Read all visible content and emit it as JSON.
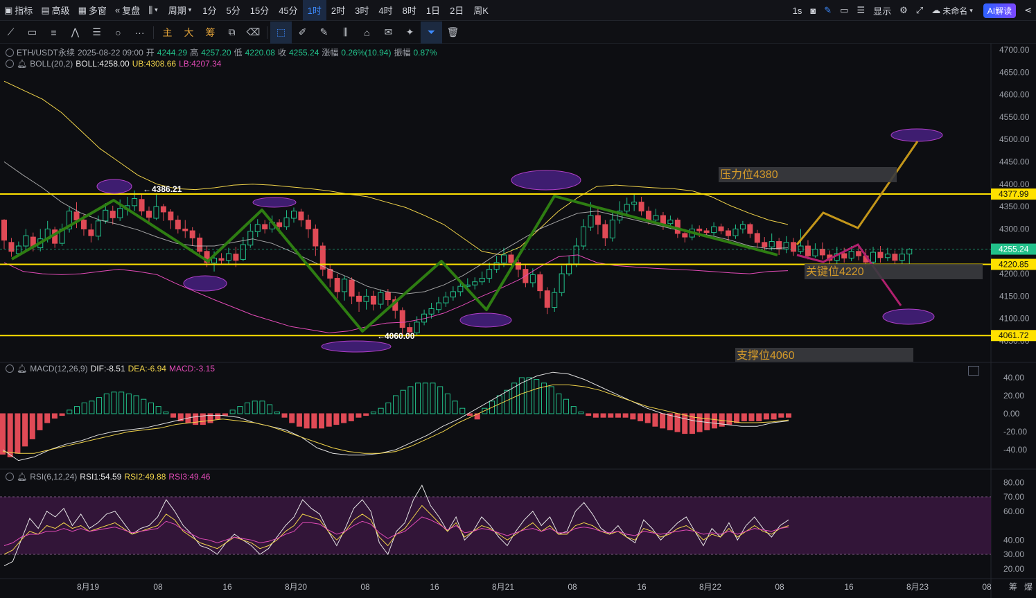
{
  "topbar": {
    "indicators": "指标",
    "advanced": "高级",
    "multi_window": "多窗",
    "replay": "复盘",
    "period": "周期",
    "intervals": [
      "1分",
      "5分",
      "15分",
      "45分",
      "1时",
      "2时",
      "3时",
      "4时",
      "8时",
      "1日",
      "2日",
      "周K"
    ],
    "active_interval": "1时",
    "refresh": "1s",
    "display": "显示",
    "unnamed": "未命名",
    "ai_read": "AI解读"
  },
  "toolbar": {
    "labels": [
      "主",
      "大",
      "筹"
    ]
  },
  "main_legend": {
    "symbol": "ETH/USDT永续",
    "datetime": "2025-08-22 09:00",
    "open_label": "开",
    "open": "4244.29",
    "high_label": "高",
    "high": "4257.20",
    "low_label": "低",
    "low": "4220.08",
    "close_label": "收",
    "close": "4255.24",
    "change_label": "涨幅",
    "change": "0.26%(10.94)",
    "amp_label": "振幅",
    "amp": "0.87%"
  },
  "boll_legend": {
    "name": "BOLL(20,2)",
    "boll": "BOLL:4258.00",
    "ub": "UB:4308.66",
    "lb": "LB:4207.34"
  },
  "macd_legend": {
    "name": "MACD(12,26,9)",
    "dif": "DIF:-8.51",
    "dea": "DEA:-6.94",
    "macd": "MACD:-3.15"
  },
  "rsi_legend": {
    "name": "RSI(6,12,24)",
    "rsi1": "RSI1:54.59",
    "rsi2": "RSI2:49.88",
    "rsi3": "RSI3:49.46"
  },
  "price_axis": [
    "4700.00",
    "4650.00",
    "4600.00",
    "4550.00",
    "4500.00",
    "4450.00",
    "4400.00",
    "4350.00",
    "4300.00",
    "4250.00",
    "4200.00",
    "4150.00",
    "4100.00",
    "4050.00"
  ],
  "price_tags": {
    "top_line": "4377.99",
    "current": "4255.24",
    "mid_line": "4220.85",
    "bottom_line": "4061.72"
  },
  "annotations": {
    "high_mark": "4386.21",
    "low_mark": "4060.00",
    "resistance": "压力位4380",
    "key": "关键位4220",
    "support": "支撑位4060"
  },
  "macd_axis": [
    "40.00",
    "20.00",
    "0.00",
    "-20.00",
    "-40.00"
  ],
  "rsi_axis": [
    "80.00",
    "70.00",
    "60.00",
    "40.00",
    "30.00",
    "20.00"
  ],
  "time_axis": [
    "8月19",
    "08",
    "16",
    "8月20",
    "08",
    "16",
    "8月21",
    "08",
    "16",
    "8月22",
    "08",
    "16",
    "8月23",
    "08"
  ],
  "corner": [
    "筹",
    "爆"
  ],
  "colors": {
    "up": "#22c08a",
    "down": "#e04a56",
    "boll_mid": "#c9c9c9",
    "boll_band": "#f0d34a",
    "boll_low": "#e24bb7",
    "level_line": "#ffe100",
    "trend": "#2e7d12",
    "forecast_up": "#c3961a",
    "forecast_down": "#b0206e"
  }
}
